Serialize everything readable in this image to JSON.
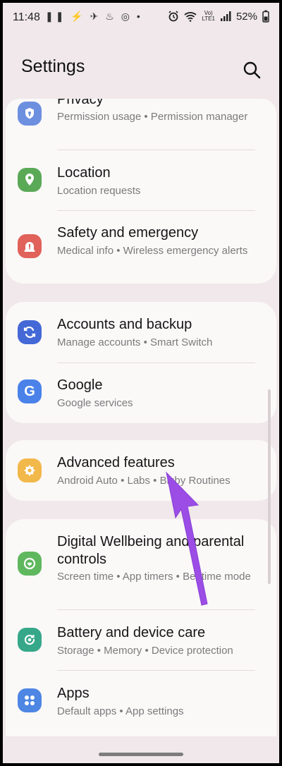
{
  "status_bar": {
    "time": "11:48",
    "notif_icons": "❚❚ ⚡ ✈ ♨ ◎ •",
    "volte": "Vo)\nLTE1",
    "battery": "52%"
  },
  "header": {
    "title": "Settings"
  },
  "groups": [
    {
      "items": [
        {
          "title": "Privacy",
          "subtitle": "Permission usage  •  Permission manager",
          "icon": "shield-icon",
          "color": "#6d8fe0"
        },
        {
          "title": "Location",
          "subtitle": "Location requests",
          "icon": "location-pin-icon",
          "color": "#5aa957"
        },
        {
          "title": "Safety and emergency",
          "subtitle": "Medical info  •  Wireless emergency alerts",
          "icon": "emergency-icon",
          "color": "#e0625a"
        }
      ]
    },
    {
      "items": [
        {
          "title": "Accounts and backup",
          "subtitle": "Manage accounts  •  Smart Switch",
          "icon": "sync-icon",
          "color": "#4468d6"
        },
        {
          "title": "Google",
          "subtitle": "Google services",
          "icon": "google-icon",
          "color": "#4a82ea"
        }
      ]
    },
    {
      "items": [
        {
          "title": "Advanced features",
          "subtitle": "Android Auto  •  Labs  •  Bixby Routines",
          "icon": "advanced-features-icon",
          "color": "#f2b84a"
        }
      ]
    },
    {
      "items": [
        {
          "title": "Digital Wellbeing and parental controls",
          "subtitle": "Screen time  •  App timers  •  Bedtime mode",
          "icon": "wellbeing-icon",
          "color": "#5fb85e"
        },
        {
          "title": "Battery and device care",
          "subtitle": "Storage  •  Memory  •  Device protection",
          "icon": "device-care-icon",
          "color": "#36a889"
        },
        {
          "title": "Apps",
          "subtitle": "Default apps  •  App settings",
          "icon": "apps-icon",
          "color": "#4d86e3"
        }
      ]
    }
  ],
  "colors": {
    "background": "#f0e8ea",
    "card": "#fbf8f8",
    "arrow": "#9b4de6"
  }
}
